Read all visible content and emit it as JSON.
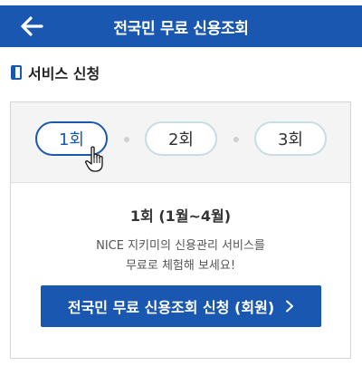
{
  "header": {
    "title": "전국민 무료 신용조회"
  },
  "section": {
    "title": "서비스 신청"
  },
  "tabs": [
    {
      "label": "1회",
      "active": true
    },
    {
      "label": "2회",
      "active": false
    },
    {
      "label": "3회",
      "active": false
    }
  ],
  "round": {
    "title": "1회 (1월~4월)",
    "desc_line1": "NICE 지키미의 신용관리 서비스를",
    "desc_line2": "무료로 체험해 보세요!"
  },
  "cta": {
    "label": "전국민 무료 신용조회 신청 (회원)"
  },
  "colors": {
    "primary": "#1a57b0",
    "pill_border": "#c7dde2",
    "panel_bg": "#f4f4f4"
  },
  "icons": [
    "back-arrow-icon",
    "book-icon",
    "hand-cursor-icon",
    "chevron-right-icon"
  ]
}
